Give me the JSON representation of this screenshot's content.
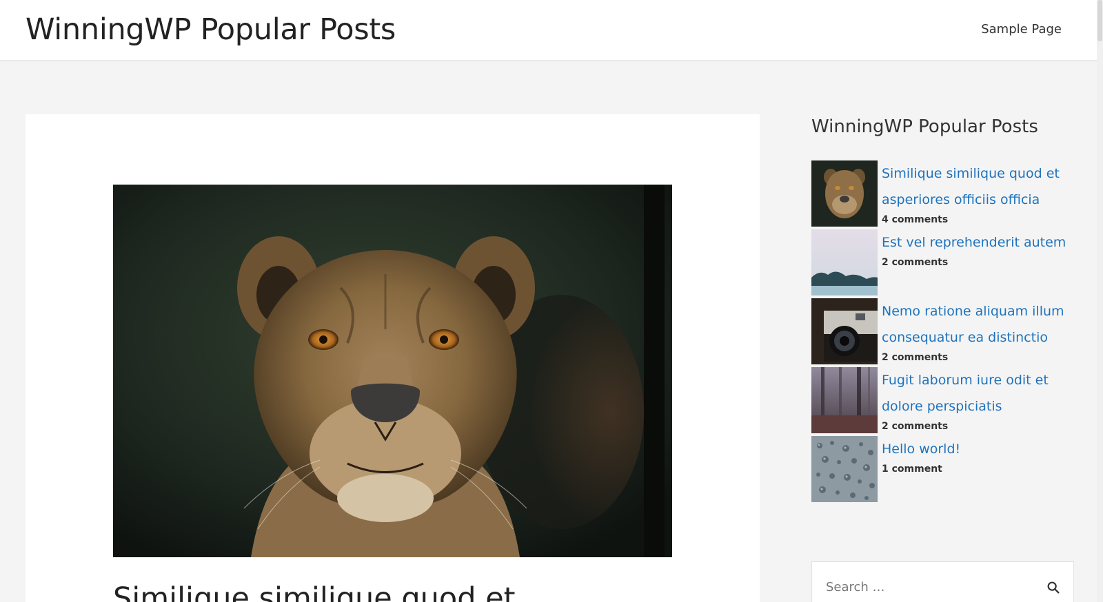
{
  "header": {
    "site_title": "WinningWP Popular Posts",
    "nav": [
      {
        "label": "Sample Page"
      }
    ]
  },
  "article": {
    "title": "Similique similique quod et",
    "featured_image": "lioness-photo"
  },
  "sidebar": {
    "widget_title": "WinningWP Popular Posts",
    "posts": [
      {
        "title": "Similique similique quod et asperiores officiis officia",
        "comments": "4 comments",
        "thumb": "lioness-thumb"
      },
      {
        "title": "Est vel reprehenderit autem",
        "comments": "2 comments",
        "thumb": "misty-lake-thumb"
      },
      {
        "title": "Nemo ratione aliquam illum consequatur ea distinctio",
        "comments": "2 comments",
        "thumb": "camera-thumb"
      },
      {
        "title": "Fugit laborum iure odit et dolore perspiciatis",
        "comments": "2 comments",
        "thumb": "forest-thumb"
      },
      {
        "title": "Hello world!",
        "comments": "1 comment",
        "thumb": "water-drops-thumb"
      }
    ],
    "search": {
      "placeholder": "Search …",
      "icon": "search-icon"
    }
  },
  "colors": {
    "link": "#1e73be",
    "background": "#f4f4f4",
    "card": "#ffffff"
  }
}
